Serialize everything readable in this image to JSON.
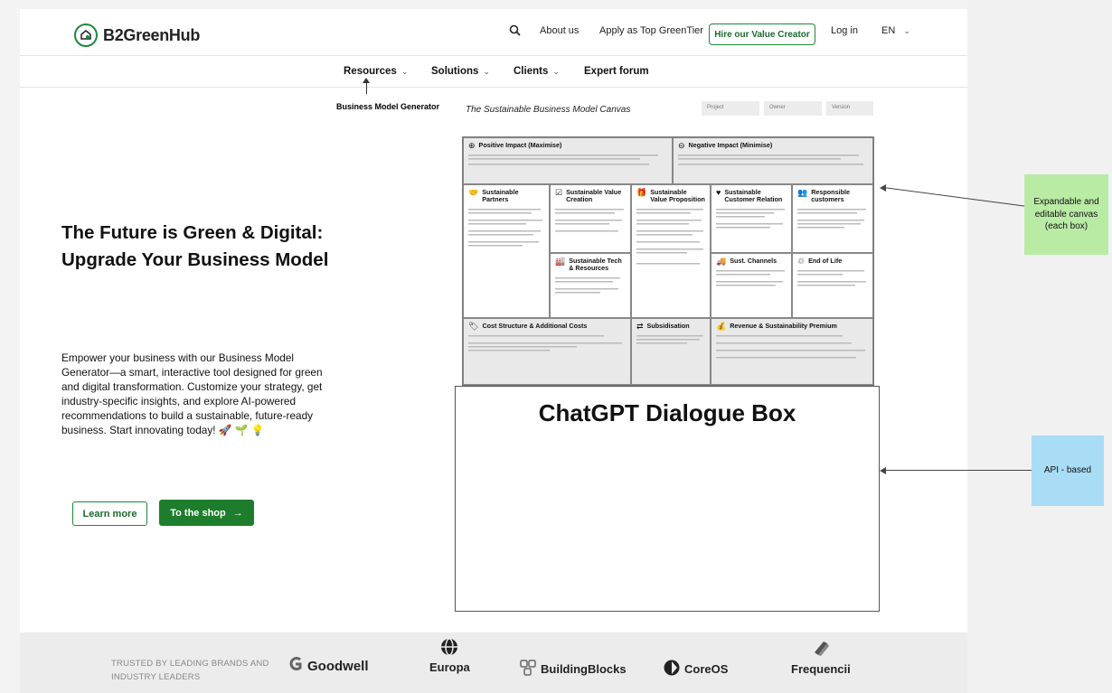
{
  "header": {
    "logo": "B2GreenHub",
    "nav": {
      "about": "About us",
      "apply": "Apply as Top GreenTier",
      "hire": "Hire our Value Creator",
      "login": "Log in",
      "lang": "EN"
    }
  },
  "menu": {
    "resources": "Resources",
    "solutions": "Solutions",
    "clients": "Clients",
    "forum": "Expert forum"
  },
  "bmg_label": "Business Model Generator",
  "hero": {
    "title": "The Future is Green & Digital: Upgrade Your Business Model",
    "description": "Empower your business with our Business Model Generator—a smart, interactive tool designed for green and digital transformation. Customize your strategy, get industry-specific insights, and explore AI-powered recommendations to build a sustainable, future-ready business. Start innovating today! 🚀 🌱 💡",
    "learn_more": "Learn more",
    "to_shop": "To the shop",
    "shop_arrow": "→"
  },
  "canvas": {
    "title": "The Sustainable Business Model Canvas",
    "fields": [
      "Project",
      "Owner",
      "Version"
    ],
    "cells": {
      "positive": {
        "title": "Positive Impact (Maximise)",
        "icon": "plus-circle-icon"
      },
      "negative": {
        "title": "Negative Impact (Minimise)",
        "icon": "minus-circle-icon"
      },
      "partners": {
        "title": "Sustainable Partners",
        "icon": "handshake-icon"
      },
      "value_creation": {
        "title": "Sustainable Value Creation",
        "icon": "checkbox-icon"
      },
      "value_prop": {
        "title": "Sustainable Value Proposition",
        "icon": "gift-icon"
      },
      "customer_rel": {
        "title": "Sustainable Customer Relation",
        "icon": "heart-icon"
      },
      "customers": {
        "title": "Responsible customers",
        "icon": "people-icon"
      },
      "tech": {
        "title": "Sustainable Tech & Resources",
        "icon": "factory-icon"
      },
      "channels": {
        "title": "Sust. Channels",
        "icon": "truck-icon"
      },
      "end_of_life": {
        "title": "End of Life",
        "icon": "recycle-icon"
      },
      "cost": {
        "title": "Cost Structure & Additional Costs",
        "icon": "tag-icon"
      },
      "subsidisation": {
        "title": "Subsidisation",
        "icon": "arrows-icon"
      },
      "revenue": {
        "title": "Revenue & Sustainability Premium",
        "icon": "moneybag-icon"
      }
    }
  },
  "chat": {
    "title": "ChatGPT Dialogue Box"
  },
  "annotations": {
    "green": "Expandable and editable canvas (each box)",
    "blue": "API - based"
  },
  "footer": {
    "trusted": "TRUSTED BY LEADING BRANDS AND INDUSTRY LEADERS",
    "brands": [
      "Goodwell",
      "Europa",
      "BuildingBlocks",
      "CoreOS",
      "Frequencii"
    ]
  },
  "colors": {
    "accent": "#1d7d2c",
    "annotation_green": "#b9eba5",
    "annotation_blue": "#a9dcf5"
  }
}
